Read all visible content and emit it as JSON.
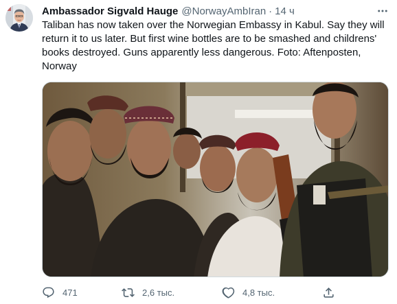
{
  "tweet": {
    "author_name": "Ambassador Sigvald Hauge",
    "author_handle": "@NorwayAmbIran",
    "separator": "·",
    "timestamp": "14 ч",
    "text": "Taliban has now taken over the Norwegian Embassy in Kabul. Say they will return it to us later. But first wine bottles are to be smashed and childrens' books destroyed. Guns apparently less dangerous. Foto: Aftenposten, Norway",
    "avatar_icon": "profile-photo",
    "more_icon": "more-dots-icon"
  },
  "media": {
    "icon": "photo-of-armed-men"
  },
  "actions": {
    "reply_icon": "reply-icon",
    "reply_count": "471",
    "retweet_icon": "retweet-icon",
    "retweet_count": "2,6 тыс.",
    "like_icon": "heart-icon",
    "like_count": "4,8 тыс.",
    "share_icon": "share-icon"
  },
  "colors": {
    "text_primary": "#0f1419",
    "text_secondary": "#536471",
    "border": "#cfd9de"
  }
}
